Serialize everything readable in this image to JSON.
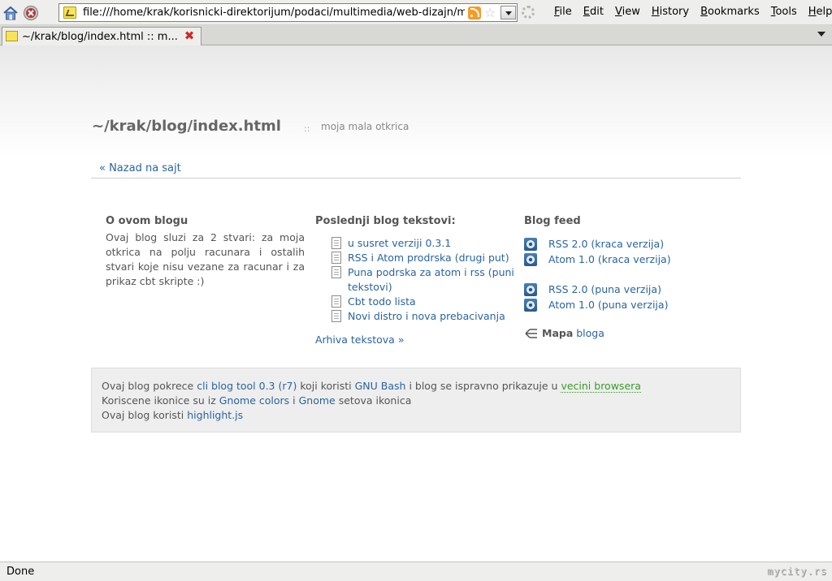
{
  "browser": {
    "url": "file:///home/krak/korisnicki-direktorijum/podaci/multimedia/web-dizajn/my-",
    "menu": [
      "File",
      "Edit",
      "View",
      "History",
      "Bookmarks",
      "Tools",
      "Help"
    ],
    "tab_title": "~/krak/blog/index.html :: m...",
    "status": "Done",
    "watermark": "mycity.rs"
  },
  "header": {
    "title": "~/krak/blog/index.html",
    "separator": "::",
    "subtitle": "moja mala otkrica",
    "back_link": "« Nazad na sajt"
  },
  "about": {
    "heading": "O ovom blogu",
    "text": "Ovaj blog sluzi za 2 stvari: za moja otkrica na polju racunara i ostalih stvari koje nisu vezane za racunar i za prikaz cbt skripte :)"
  },
  "posts": {
    "heading": "Poslednji blog tekstovi:",
    "items": [
      "u susret verziji 0.3.1",
      "RSS i Atom prodrska (drugi put)",
      "Puna podrska za atom i rss (puni tekstovi)",
      "Cbt todo lista",
      "Novi distro i nova prebacivanja"
    ],
    "archive": "Arhiva tekstova »"
  },
  "feed": {
    "heading": "Blog feed",
    "short_feeds": [
      "RSS 2.0 (kraca verzija)",
      "Atom 1.0 (kraca verzija)"
    ],
    "full_feeds": [
      "RSS 2.0 (puna verzija)",
      "Atom 1.0 (puna verzija)"
    ],
    "sitemap_label": "Mapa",
    "sitemap_link": "bloga"
  },
  "footer": {
    "line1": {
      "t1": "Ovaj blog pokrece",
      "l1": "cli blog tool 0.3 (r7)",
      "t2": "koji koristi",
      "l2": "GNU Bash",
      "t3": "i blog se ispravno prikazuje u",
      "l3": "vecini browsera"
    },
    "line2": {
      "t1": "Koriscene ikonice su iz",
      "l1": "Gnome colors",
      "t2": "i",
      "l2": "Gnome",
      "t3": "setova ikonica"
    },
    "line3": {
      "t1": "Ovaj blog koristi",
      "l1": "highlight.js"
    }
  }
}
